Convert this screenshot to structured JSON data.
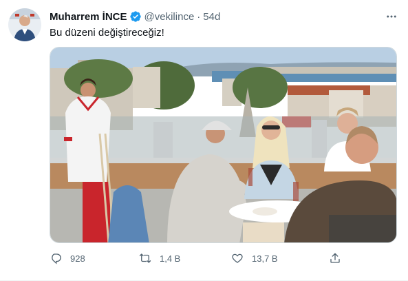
{
  "tweet": {
    "author": {
      "display_name": "Muharrem İNCE",
      "handle": "@vekilince",
      "verified": true
    },
    "separator": "·",
    "time": "54d",
    "text": "Bu düzeni değiştireceğiz!",
    "stats": {
      "replies": "928",
      "retweets": "1,4 B",
      "likes": "13,7 B"
    }
  },
  "icons": {
    "verified": "verified-badge-icon",
    "more": "more-horizontal-icon",
    "reply": "reply-icon",
    "retweet": "retweet-icon",
    "like": "heart-icon",
    "share": "share-icon"
  },
  "colors": {
    "text_primary": "#0f1419",
    "text_secondary": "#536471",
    "verified_blue": "#1d9bf0",
    "border": "#cfd9de"
  }
}
